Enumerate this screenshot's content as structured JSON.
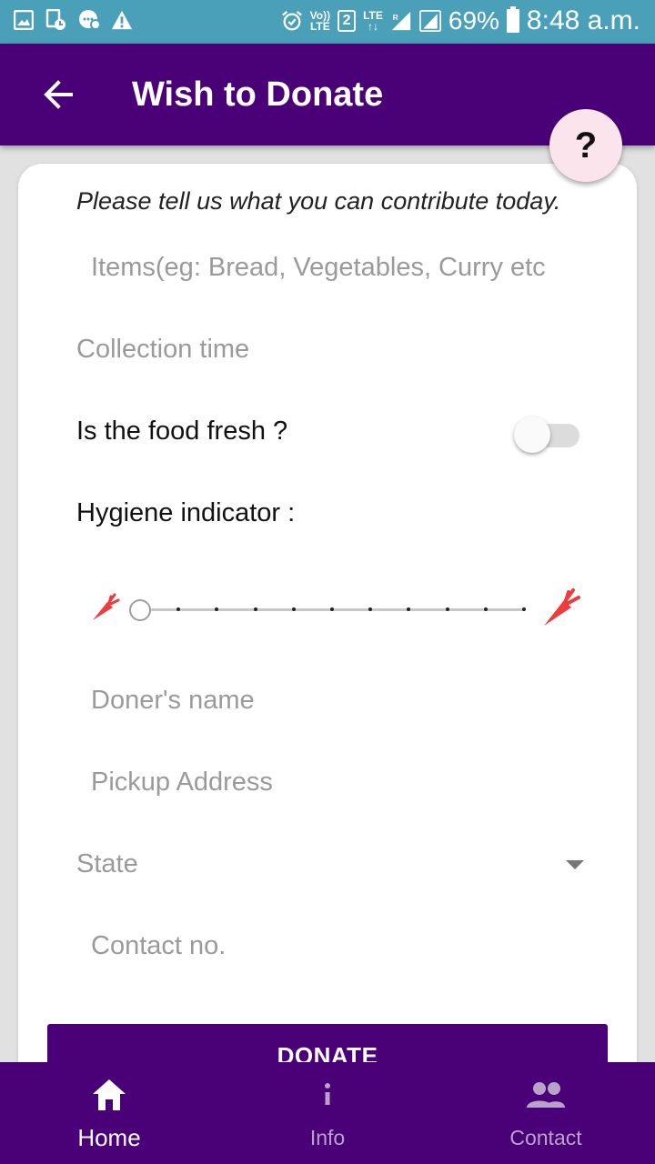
{
  "status_bar": {
    "battery": "69%",
    "time": "8:48 a.m.",
    "volte_top": "Vo))",
    "volte_bottom": "LTE",
    "sim_slot": "2",
    "network": "LTE",
    "roaming": "R"
  },
  "app_bar": {
    "title": "Wish to Donate",
    "help_label": "?"
  },
  "form": {
    "intro": "Please tell us what you can contribute today.",
    "items_placeholder": "Items(eg: Bread, Vegetables, Curry etc",
    "collection_time_placeholder": "Collection time",
    "fresh_label": "Is the food fresh ?",
    "fresh_value": false,
    "hygiene_label": "Hygiene indicator :",
    "hygiene_value": 0,
    "hygiene_max": 10,
    "doner_name_placeholder": "Doner's name",
    "pickup_address_placeholder": "Pickup Address",
    "state_placeholder": "State",
    "contact_placeholder": "Contact no.",
    "donate_label": "DONATE"
  },
  "bottom_nav": {
    "items": [
      {
        "label": "Home",
        "icon": "home-icon",
        "active": true
      },
      {
        "label": "Info",
        "icon": "info-icon",
        "active": false
      },
      {
        "label": "Contact",
        "icon": "people-icon",
        "active": false
      }
    ]
  },
  "colors": {
    "primary": "#4a0077",
    "status_bar": "#4aa0b8",
    "help_bg": "#fce4ec",
    "carrot": "#ef3b3b"
  }
}
